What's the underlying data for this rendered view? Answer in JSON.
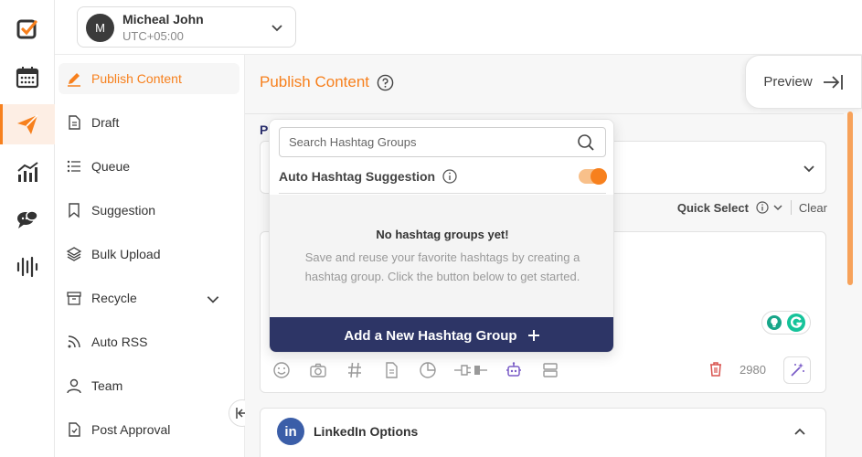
{
  "account": {
    "initial": "M",
    "name": "Micheal John",
    "timezone": "UTC+05:00"
  },
  "rail": {
    "icons": [
      "logo-check-icon",
      "calendar-icon",
      "send-icon",
      "analytics-icon",
      "chat-icon",
      "waveform-icon"
    ],
    "active": "send-icon"
  },
  "sidebar": {
    "items": [
      {
        "label": "Publish Content",
        "icon": "pencil-icon"
      },
      {
        "label": "Draft",
        "icon": "document-icon"
      },
      {
        "label": "Queue",
        "icon": "list-icon"
      },
      {
        "label": "Suggestion",
        "icon": "bookmark-icon"
      },
      {
        "label": "Bulk Upload",
        "icon": "layers-icon"
      },
      {
        "label": "Recycle",
        "icon": "archive-icon"
      },
      {
        "label": "Auto RSS",
        "icon": "rss-icon"
      },
      {
        "label": "Team",
        "icon": "user-icon"
      },
      {
        "label": "Post Approval",
        "icon": "approval-icon"
      }
    ]
  },
  "main": {
    "title": "Publish Content",
    "preview_label": "Preview",
    "card_label": "P",
    "quick_select": "Quick Select",
    "clear": "Clear",
    "char_count": "2980",
    "linkedin_title": "LinkedIn Options",
    "linkedin_icon_text": "in"
  },
  "hashtag_popover": {
    "search_placeholder": "Search Hashtag Groups",
    "auto_label": "Auto Hashtag Suggestion",
    "auto_enabled": true,
    "empty_title": "No hashtag groups yet!",
    "empty_desc": "Save and reuse your favorite hashtags by creating a hashtag group. Click the button below to get started.",
    "add_button": "Add a New Hashtag Group"
  },
  "colors": {
    "accent": "#f7801d",
    "navy": "#2d3566",
    "linkedin": "#3b5ea8"
  }
}
